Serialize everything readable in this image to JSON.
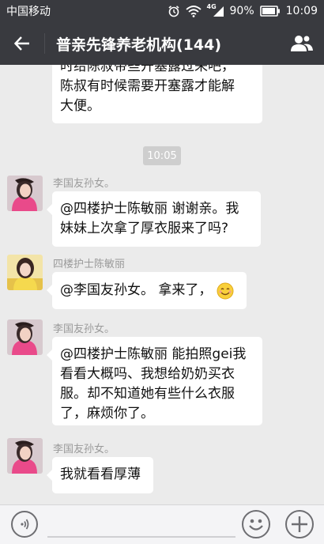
{
  "status_bar": {
    "carrier": "中国移动",
    "network": "4G",
    "battery_level": "90%",
    "time": "10:09"
  },
  "header": {
    "title": "普亲先锋养老机构(144)",
    "back_icon": "arrow-left-icon",
    "contacts_icon": "group-contacts-icon"
  },
  "messages": [
    {
      "text_lines": [
        "时给陈叔带些开塞露过来吧，",
        "陈叔有时候需要开塞露才能解",
        "大便。"
      ]
    },
    {
      "timestamp": "10:05"
    },
    {
      "sender": "李国友孙女。",
      "text_lines": [
        "@四楼护士陈敏丽 谢谢亲。我",
        "妹妹上次拿了厚衣服来了吗?"
      ]
    },
    {
      "sender": "四楼护士陈敏丽",
      "text_lines": [
        "@李国友孙女。 拿来了，"
      ],
      "emoji": "smiley-emoji"
    },
    {
      "sender": "李国友孙女。",
      "text_lines": [
        "@四楼护士陈敏丽 能拍照gei我",
        "看看大概吗、我想给奶奶买衣",
        "服。却不知道她有些什么衣服",
        "了，麻烦你了。"
      ]
    },
    {
      "sender": "李国友孙女。",
      "text_lines": [
        "我就看看厚薄"
      ]
    }
  ],
  "input_bar": {
    "voice_icon": "voice-icon",
    "emoji_icon": "emoji-icon",
    "add_icon": "plus-icon"
  },
  "colors": {
    "bar_bg": "#393a3f",
    "chat_bg": "#ebebeb",
    "bubble_bg": "#ffffff",
    "sender_name": "#9a9a9a"
  }
}
